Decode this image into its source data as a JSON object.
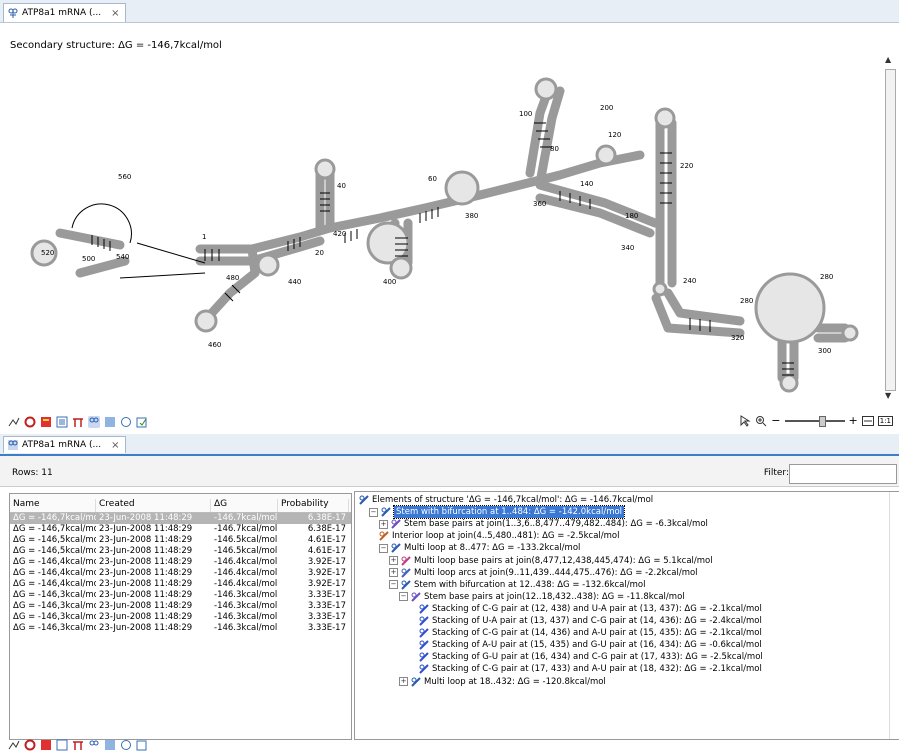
{
  "editor": {
    "tab_label": "ATP8a1 mRNA (...",
    "close_glyph": "×",
    "structure_title": "Secondary structure: ΔG = -146,7kcal/mol",
    "position_labels": [
      "1",
      "20",
      "40",
      "60",
      "80",
      "100",
      "120",
      "140",
      "180",
      "200",
      "220",
      "240",
      "280",
      "280",
      "300",
      "320",
      "340",
      "360",
      "380",
      "400",
      "420",
      "440",
      "460",
      "480",
      "500",
      "520",
      "540",
      "560"
    ],
    "scroll_up": "▲",
    "scroll_down": "▼",
    "zoom_minus": "−",
    "zoom_plus": "+",
    "zoom_one": "1:1"
  },
  "table_view": {
    "tab_label": "ATP8a1 mRNA (...",
    "close_glyph": "×",
    "rows_label": "Rows: 11",
    "filter_label": "Filter:",
    "filter_value": "",
    "columns": [
      "Name",
      "Created",
      "ΔG",
      "Probability"
    ],
    "rows": [
      [
        "ΔG = -146,7kcal/mol",
        "23-Jun-2008 11:48:29",
        "-146.7kcal/mol",
        "6.38E-17"
      ],
      [
        "ΔG = -146,7kcal/mol",
        "23-Jun-2008 11:48:29",
        "-146.7kcal/mol",
        "6.38E-17"
      ],
      [
        "ΔG = -146,5kcal/mol",
        "23-Jun-2008 11:48:29",
        "-146.5kcal/mol",
        "4.61E-17"
      ],
      [
        "ΔG = -146,5kcal/mol",
        "23-Jun-2008 11:48:29",
        "-146.5kcal/mol",
        "4.61E-17"
      ],
      [
        "ΔG = -146,4kcal/mol",
        "23-Jun-2008 11:48:29",
        "-146.4kcal/mol",
        "3.92E-17"
      ],
      [
        "ΔG = -146,4kcal/mol",
        "23-Jun-2008 11:48:29",
        "-146.4kcal/mol",
        "3.92E-17"
      ],
      [
        "ΔG = -146,4kcal/mol",
        "23-Jun-2008 11:48:29",
        "-146.4kcal/mol",
        "3.92E-17"
      ],
      [
        "ΔG = -146,3kcal/mol",
        "23-Jun-2008 11:48:29",
        "-146.3kcal/mol",
        "3.33E-17"
      ],
      [
        "ΔG = -146,3kcal/mol",
        "23-Jun-2008 11:48:29",
        "-146.3kcal/mol",
        "3.33E-17"
      ],
      [
        "ΔG = -146,3kcal/mol",
        "23-Jun-2008 11:48:29",
        "-146.3kcal/mol",
        "3.33E-17"
      ],
      [
        "ΔG = -146,3kcal/mol",
        "23-Jun-2008 11:48:29",
        "-146.3kcal/mol",
        "3.33E-17"
      ]
    ],
    "tree": [
      {
        "label": "Elements of structure 'ΔG = -146,7kcal/mol': ΔG = -146.7kcal/mol",
        "icon": "rna-structure-icon"
      },
      {
        "label": "Stem with bifurcation at 1..484: ΔG = -142.0kcal/mol",
        "icon": "stem-bifurcation-icon"
      },
      {
        "label": "Stem base pairs at join(1..3,6..8,477..479,482..484): ΔG = -6.3kcal/mol",
        "icon": "stem-base-pairs-icon"
      },
      {
        "label": "Interior loop at join(4..5,480..481): ΔG = -2.5kcal/mol",
        "icon": "interior-loop-icon"
      },
      {
        "label": "Multi loop at 8..477: ΔG = -133.2kcal/mol",
        "icon": "multi-loop-icon"
      },
      {
        "label": "Multi loop base pairs at join(8,477,12,438,445,474): ΔG = 5.1kcal/mol",
        "icon": "multi-loop-base-pairs-icon"
      },
      {
        "label": "Multi loop arcs at join(9..11,439..444,475..476): ΔG = -2.2kcal/mol",
        "icon": "multi-loop-arcs-icon"
      },
      {
        "label": "Stem with bifurcation at 12..438: ΔG = -132.6kcal/mol",
        "icon": "stem-bifurcation-icon"
      },
      {
        "label": "Stem base pairs at join(12..18,432..438): ΔG = -11.8kcal/mol",
        "icon": "stem-base-pairs-icon"
      },
      {
        "label": "Stacking of C-G pair at (12, 438) and U-A pair at (13, 437): ΔG = -2.1kcal/mol",
        "icon": "stacking-icon"
      },
      {
        "label": "Stacking of U-A pair at (13, 437) and C-G pair at (14, 436): ΔG = -2.4kcal/mol",
        "icon": "stacking-icon"
      },
      {
        "label": "Stacking of C-G pair at (14, 436) and A-U pair at (15, 435): ΔG = -2.1kcal/mol",
        "icon": "stacking-icon"
      },
      {
        "label": "Stacking of A-U pair at (15, 435) and G-U pair at (16, 434): ΔG = -0.6kcal/mol",
        "icon": "stacking-icon"
      },
      {
        "label": "Stacking of G-U pair at (16, 434) and C-G pair at (17, 433): ΔG = -2.5kcal/mol",
        "icon": "stacking-icon"
      },
      {
        "label": "Stacking of C-G pair at (17, 433) and A-U pair at (18, 432): ΔG = -2.1kcal/mol",
        "icon": "stacking-icon"
      },
      {
        "label": "Multi loop at 18..432: ΔG = -120.8kcal/mol",
        "icon": "multi-loop-icon"
      }
    ]
  },
  "colors": {
    "tab_bg": "#e8eef6",
    "selection_blue": "#3a78d4",
    "structure_stroke": "#9a9a9a",
    "structure_fill": "#e6e6e6"
  }
}
